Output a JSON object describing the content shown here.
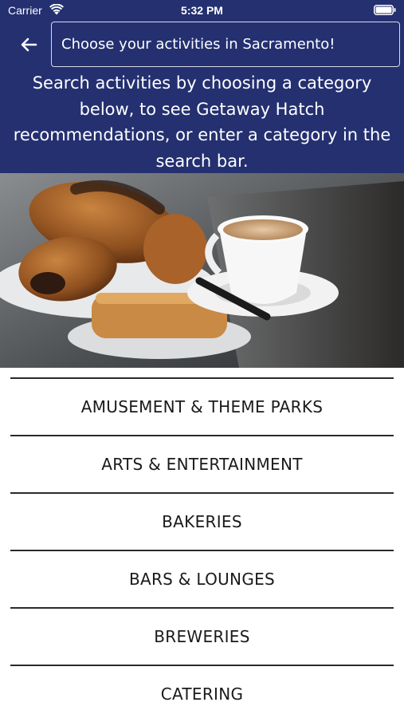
{
  "status_bar": {
    "carrier": "Carrier",
    "time": "5:32 PM",
    "wifi_icon": "wifi-icon",
    "battery_icon": "battery-icon"
  },
  "header": {
    "background_color": "#243070",
    "back_icon": "arrow-left-icon",
    "search_placeholder": "Choose your activities in Sacramento!",
    "intro_text": "Search activities by choosing a category below, to see Getaway Hatch recommendations, or enter a category in the search bar."
  },
  "hero": {
    "image": "pastries-and-coffee-photo"
  },
  "categories": [
    {
      "label": "AMUSEMENT & THEME PARKS"
    },
    {
      "label": "ARTS & ENTERTAINMENT"
    },
    {
      "label": "BAKERIES"
    },
    {
      "label": "BARS & LOUNGES"
    },
    {
      "label": "BREWERIES"
    },
    {
      "label": "CATERING"
    }
  ]
}
